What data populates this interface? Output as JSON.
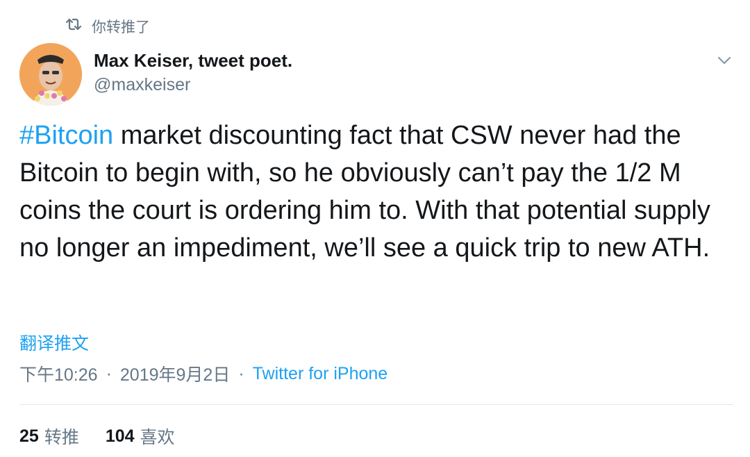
{
  "retweet_context": {
    "icon": "retweet-icon",
    "label": "你转推了"
  },
  "author": {
    "name": "Max Keiser, tweet poet.",
    "handle": "@maxkeiser",
    "avatar_bg": "#f2a55a"
  },
  "tweet": {
    "hashtag": "#Bitcoin",
    "text": " market discounting fact that CSW never had the Bitcoin to begin with, so he obviously can’t pay the 1/2 M coins the court is ordering him to. With that potential supply no longer an impediment, we’ll see a quick trip to new ATH."
  },
  "translate_label": "翻译推文",
  "meta": {
    "time": "下午10:26",
    "separator": "·",
    "date": "2019年9月2日",
    "source": "Twitter for iPhone"
  },
  "stats": {
    "retweets": {
      "count": "25",
      "label": "转推"
    },
    "likes": {
      "count": "104",
      "label": "喜欢"
    }
  },
  "colors": {
    "accent": "#1da1f2",
    "muted": "#657786",
    "text": "#14171a",
    "divider": "#e1e8ed"
  }
}
